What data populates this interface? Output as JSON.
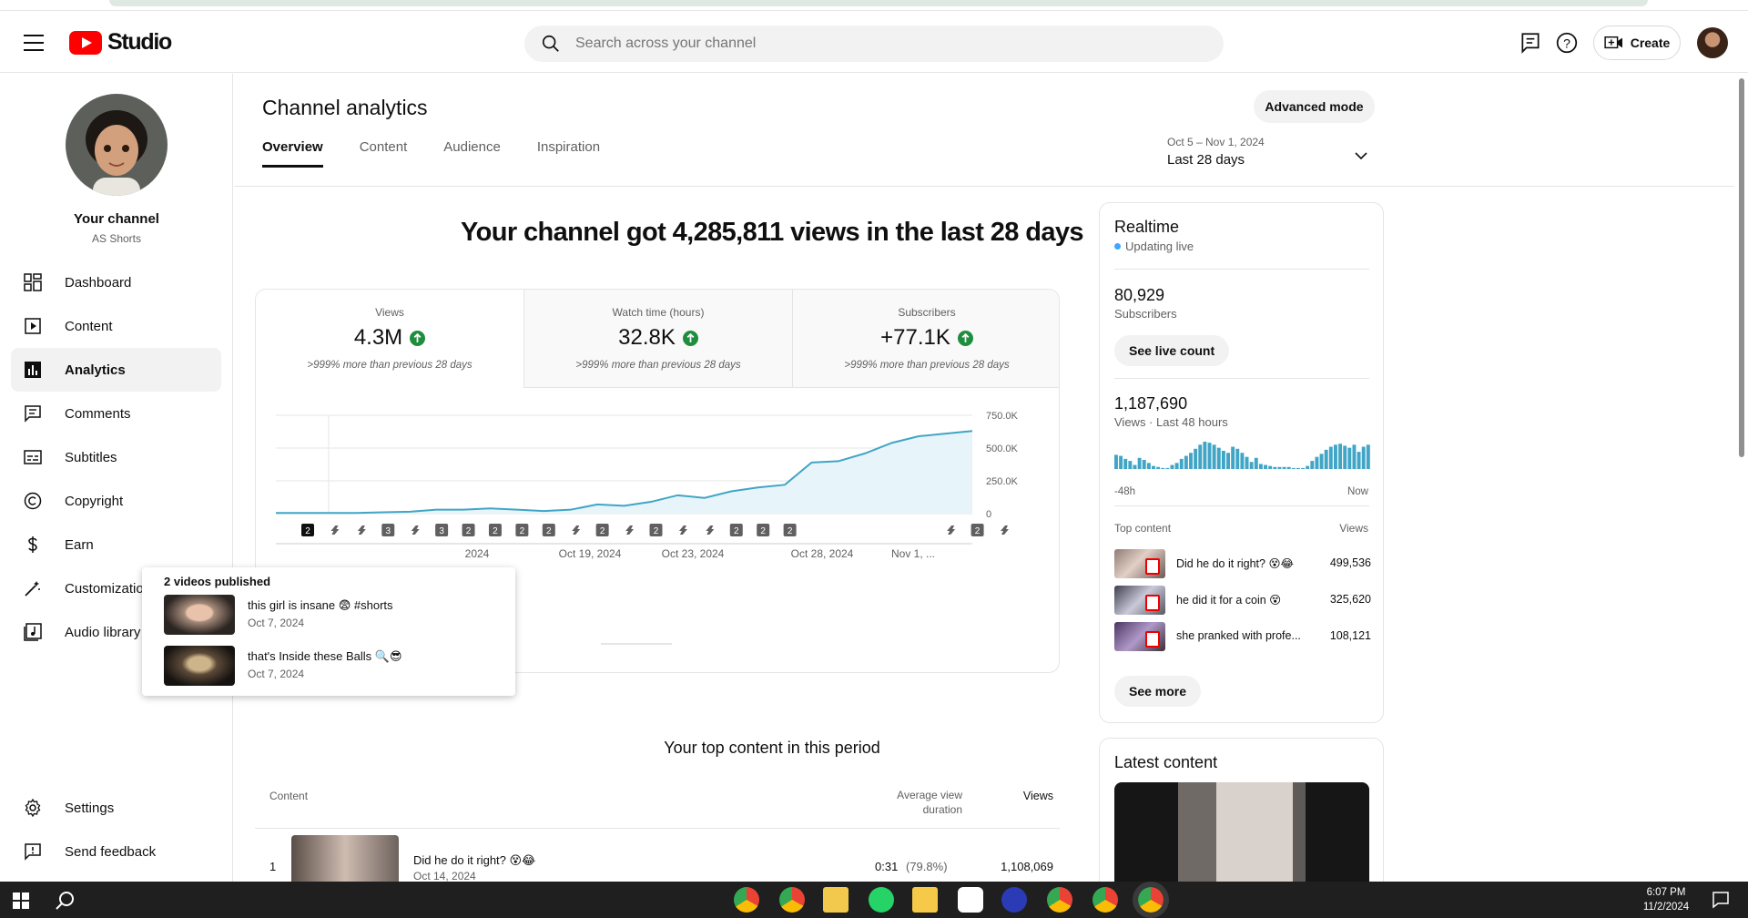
{
  "header": {
    "logo_text": "Studio",
    "search_placeholder": "Search across your channel",
    "create_label": "Create"
  },
  "sidebar": {
    "channel_name": "Your channel",
    "channel_handle": "AS Shorts",
    "items": [
      {
        "label": "Dashboard",
        "icon": "dashboard-icon"
      },
      {
        "label": "Content",
        "icon": "content-icon"
      },
      {
        "label": "Analytics",
        "icon": "analytics-icon",
        "active": true
      },
      {
        "label": "Comments",
        "icon": "comments-icon"
      },
      {
        "label": "Subtitles",
        "icon": "subtitles-icon"
      },
      {
        "label": "Copyright",
        "icon": "copyright-icon"
      },
      {
        "label": "Earn",
        "icon": "earn-icon"
      },
      {
        "label": "Customization",
        "icon": "customization-icon"
      },
      {
        "label": "Audio library",
        "icon": "audio-library-icon"
      }
    ],
    "bottom_items": [
      {
        "label": "Settings",
        "icon": "settings-icon"
      },
      {
        "label": "Send feedback",
        "icon": "feedback-icon"
      }
    ]
  },
  "main": {
    "title": "Channel analytics",
    "advanced_mode_label": "Advanced mode",
    "tabs": [
      "Overview",
      "Content",
      "Audience",
      "Inspiration"
    ],
    "date_range": {
      "dates": "Oct 5 – Nov 1, 2024",
      "label": "Last 28 days"
    },
    "headline": "Your channel got 4,285,811 views in the last 28 days",
    "metrics": [
      {
        "label": "Views",
        "value": "4.3M",
        "note": ">999% more than previous 28 days"
      },
      {
        "label": "Watch time (hours)",
        "value": "32.8K",
        "note": ">999% more than previous 28 days"
      },
      {
        "label": "Subscribers",
        "value": "+77.1K",
        "note": ">999% more than previous 28 days"
      }
    ],
    "top_content_title": "Your top content in this period",
    "table_headers": {
      "content": "Content",
      "avg_duration": "Average view duration",
      "views": "Views"
    },
    "table_rows": [
      {
        "rank": "1",
        "title": "Did he do it right? 😵😂",
        "date": "Oct 14, 2024",
        "duration": "0:31",
        "duration_pct": "(79.8%)",
        "views": "1,108,069"
      }
    ]
  },
  "tooltip": {
    "title": "2 videos published",
    "videos": [
      {
        "title": "this girl is insane 😨 #shorts",
        "date": "Oct 7, 2024"
      },
      {
        "title": "that's Inside these Balls 🔍😎",
        "date": "Oct 7, 2024"
      }
    ]
  },
  "chart_data": {
    "type": "area",
    "x_tick_labels": [
      "2024",
      "Oct 19, 2024",
      "Oct 23, 2024",
      "Oct 28, 2024",
      "Nov 1, ..."
    ],
    "y_tick_labels": [
      "750.0K",
      "500.0K",
      "250.0K",
      "0"
    ],
    "ylim": [
      0,
      750000
    ],
    "series": [
      {
        "values": [
          5000,
          5000,
          5000,
          5000,
          10000,
          15000,
          30000,
          30000,
          40000,
          30000,
          20000,
          30000,
          70000,
          60000,
          90000,
          140000,
          120000,
          170000,
          200000,
          220000,
          390000,
          400000,
          460000,
          540000,
          590000,
          610000,
          630000
        ]
      }
    ],
    "publish_markers": [
      "2",
      "s",
      "s",
      "3",
      "s",
      "3",
      "2",
      "2",
      "2",
      "2",
      "s",
      "2",
      "s",
      "2",
      "s",
      "s",
      "2",
      "2",
      "2",
      "",
      "",
      "",
      "",
      "",
      "s",
      "2",
      "s"
    ],
    "colors": {
      "line": "#41a5c6",
      "fill": "#e7f4f9"
    }
  },
  "realtime": {
    "title": "Realtime",
    "status": "Updating live",
    "subscribers_value": "80,929",
    "subscribers_label": "Subscribers",
    "see_live_label": "See live count",
    "views_value": "1,187,690",
    "views_label": "Views · Last 48 hours",
    "axis_start": "-48h",
    "axis_end": "Now",
    "bars": [
      14,
      13,
      10,
      8,
      4,
      11,
      9,
      6,
      3,
      2,
      1,
      1,
      4,
      6,
      10,
      13,
      16,
      20,
      24,
      27,
      26,
      24,
      21,
      18,
      16,
      22,
      20,
      16,
      12,
      7,
      11,
      5,
      4,
      3,
      2,
      2,
      2,
      2,
      1,
      1,
      1,
      3,
      8,
      12,
      15,
      19,
      22,
      24,
      25,
      23,
      21,
      24,
      17,
      22,
      24
    ],
    "top_content_label": "Top content",
    "top_views_label": "Views",
    "top_content": [
      {
        "title": "Did he do it right? 😵😂",
        "views": "499,536"
      },
      {
        "title": "he did it for a coin 😵",
        "views": "325,620"
      },
      {
        "title": "she pranked with profe...",
        "views": "108,121"
      }
    ],
    "see_more_label": "See more"
  },
  "latest": {
    "title": "Latest content"
  },
  "taskbar": {
    "time": "6:07 PM",
    "date": "11/2/2024"
  }
}
